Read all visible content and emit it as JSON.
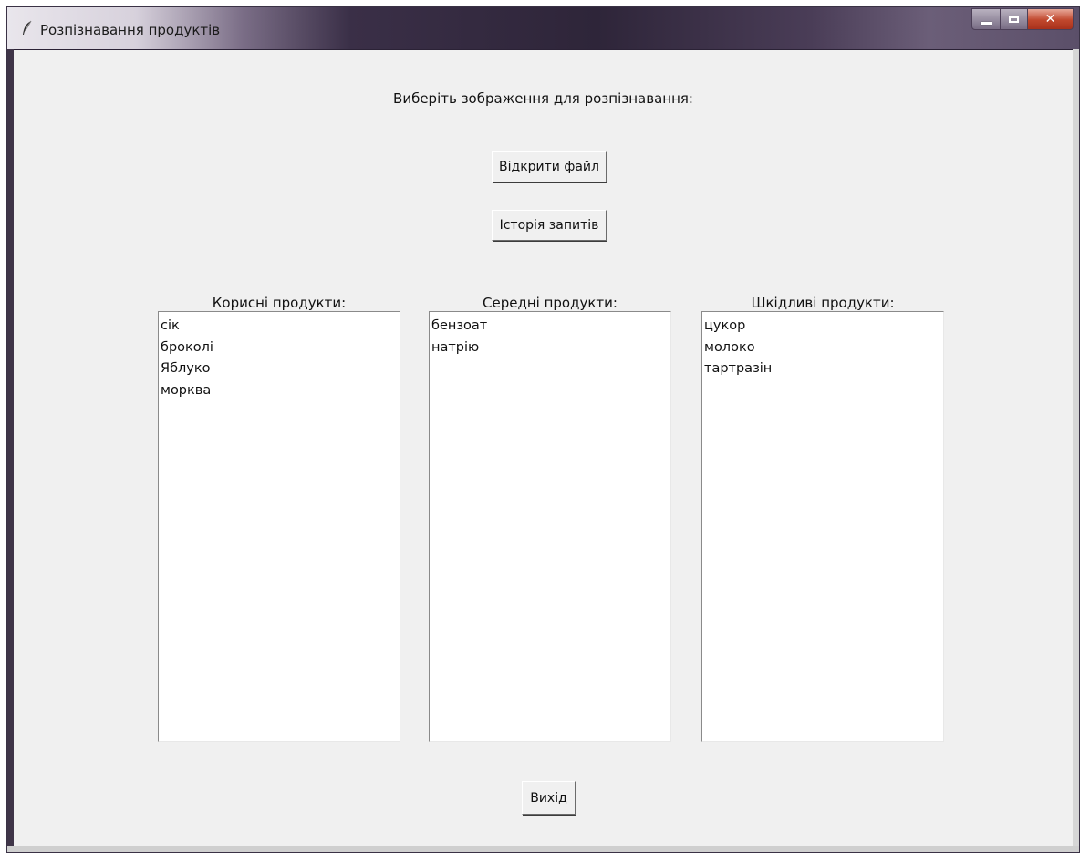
{
  "window": {
    "title": "Розпізнавання продуктів",
    "icon": "feather-icon",
    "controls": [
      "minimize-icon",
      "maximize-icon",
      "close-icon"
    ]
  },
  "main": {
    "prompt": "Виберіть зображення для розпізнавання:",
    "open_file_label": "Відкрити файл",
    "history_label": "Історія запитів",
    "exit_label": "Вихід"
  },
  "lists": {
    "healthy": {
      "title": "Корисні продукти:",
      "items": [
        "сік",
        "броколі",
        "Яблуко",
        "морква"
      ]
    },
    "medium": {
      "title": "Середні продукти:",
      "items": [
        "бензоат",
        "натрію"
      ]
    },
    "harmful": {
      "title": "Шкідливі продукти:",
      "items": [
        "цукор",
        "молоко",
        "тартразін"
      ]
    }
  }
}
